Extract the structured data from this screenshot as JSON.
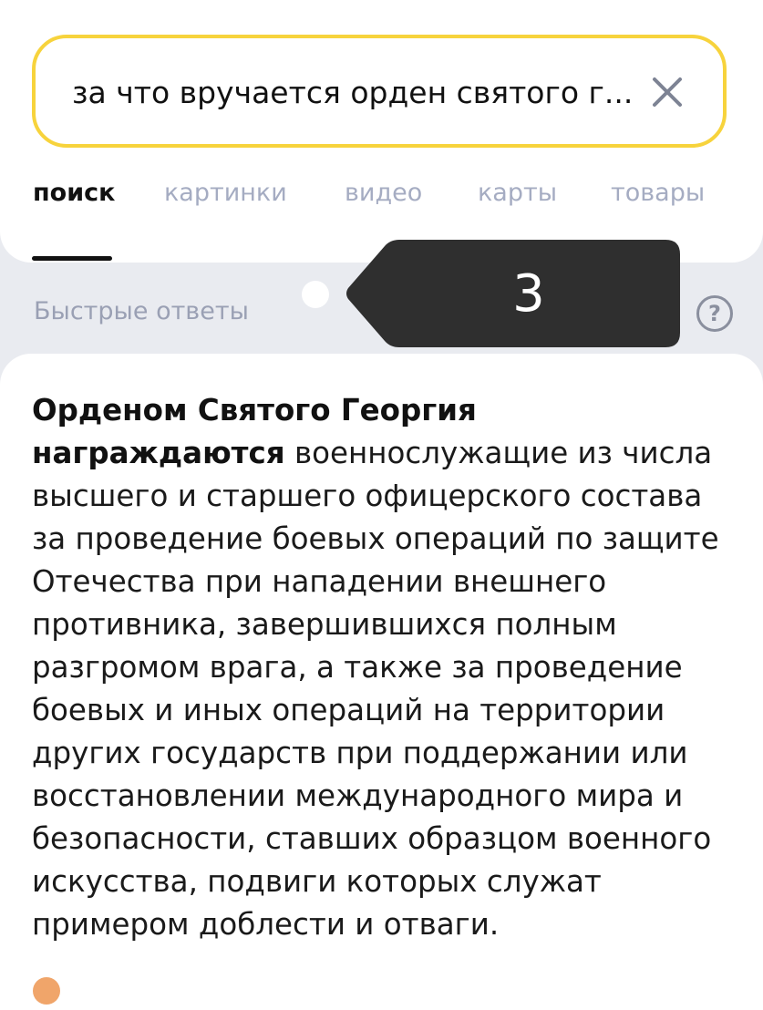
{
  "search": {
    "query": "за что вручается орден святого г..."
  },
  "tabs": [
    {
      "label": "поиск",
      "active": true
    },
    {
      "label": "картинки",
      "active": false
    },
    {
      "label": "видео",
      "active": false
    },
    {
      "label": "карты",
      "active": false
    },
    {
      "label": "товары",
      "active": false
    }
  ],
  "quick_answers": {
    "label": "Быстрые ответы",
    "help_symbol": "?"
  },
  "tooltip": {
    "number": "3"
  },
  "answer": {
    "bold": "Орденом Святого Георгия награждаются",
    "text": " военнослужащие из числа высшего и старшего офицерского состава за проведение боевых операций по защите Отечества при нападении внешнего противника, завершившихся полным разгромом врага, а также за проведение боевых и иных операций на территории других государств при поддержании или восстановлении международного мира и безопасности, ставших образцом военного искусства, подвиги которых служат примером доблести и отваги."
  },
  "colors": {
    "search_border": "#f7d33c",
    "tab_inactive": "#a5acc2",
    "tooltip_bg": "#2f2f2f",
    "page_bg": "#e9ebf0"
  },
  "icons": {
    "clear": "close-icon",
    "help": "question-circle-icon",
    "source": "source-favicon-icon"
  }
}
